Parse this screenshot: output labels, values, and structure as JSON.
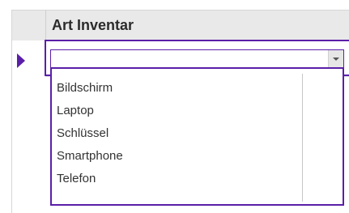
{
  "header": {
    "column_title": "Art Inventar"
  },
  "combobox": {
    "value": ""
  },
  "dropdown": {
    "options": [
      "Bildschirm",
      "Laptop",
      "Schlüssel",
      "Smartphone",
      "Telefon"
    ]
  },
  "colors": {
    "accent": "#5a1fa8",
    "header_bg": "#e9e9e9"
  },
  "icons": {
    "record_selector": "current-record-arrow-icon",
    "dropdown_button": "chevron-down-icon"
  }
}
